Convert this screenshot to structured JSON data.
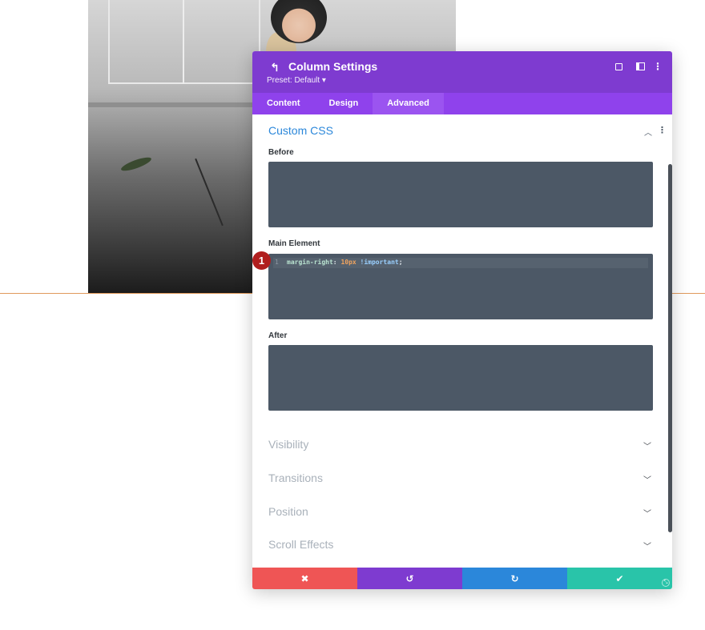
{
  "modal": {
    "title": "Column Settings",
    "preset": "Preset: Default ▾",
    "icons": {
      "back": "undo-icon",
      "focus": "focus-mode-icon",
      "split": "split-view-icon",
      "more": "more-icon"
    },
    "tabs": [
      {
        "label": "Content",
        "active": false
      },
      {
        "label": "Design",
        "active": false
      },
      {
        "label": "Advanced",
        "active": true
      }
    ]
  },
  "custom_css": {
    "title": "Custom CSS",
    "fields": [
      {
        "label": "Before",
        "code": ""
      },
      {
        "label": "Main Element",
        "line_number": "1",
        "code": {
          "property": "margin-right",
          "colon": ": ",
          "value": "10px",
          "space": " ",
          "important": "!important",
          "end": ";"
        }
      },
      {
        "label": "After",
        "code": ""
      }
    ]
  },
  "badge": "1",
  "sections": [
    {
      "label": "Visibility"
    },
    {
      "label": "Transitions"
    },
    {
      "label": "Position"
    },
    {
      "label": "Scroll Effects"
    }
  ],
  "footer": {
    "cancel": "✖",
    "undo": "↺",
    "redo": "↻",
    "save": "✔"
  },
  "colors": {
    "header": "#7e3bd0",
    "tabs": "#8f42ec",
    "accent": "#2b87da",
    "editor": "#4c5866",
    "cancel": "#ef5555",
    "save": "#29c4a9"
  }
}
